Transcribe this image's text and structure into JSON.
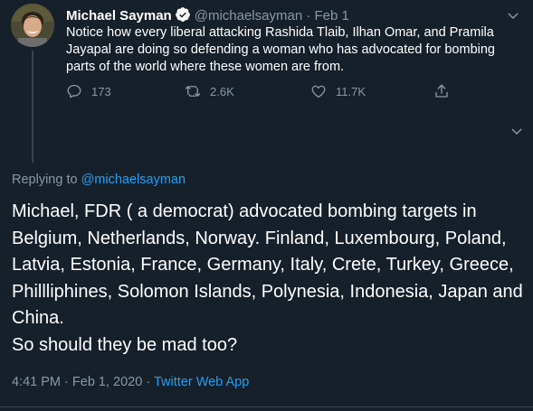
{
  "colors": {
    "background": "#15202b",
    "text_primary": "#ffffff",
    "text_secondary": "#8899a6",
    "accent": "#1da1f2",
    "divider": "#38444d"
  },
  "parent_tweet": {
    "display_name": "Michael Sayman",
    "verified_icon": "verified-badge-icon",
    "handle": "@michaelsayman",
    "separator": "·",
    "time": "Feb 1",
    "text": "Notice how every liberal attacking Rashida Tlaib, Ilhan Omar, and Pramila Jayapal are doing so defending a woman who has advocated for bombing parts of the world where these women are from.",
    "actions": {
      "reply_count": "173",
      "retweet_count": "2.6K",
      "like_count": "11.7K"
    }
  },
  "main_tweet": {
    "replying_prefix": "Replying to",
    "replying_handle": "@michaelsayman",
    "text_line1": "Michael, FDR ( a democrat) advocated bombing targets in Belgium, Netherlands, Norway. Finland, Luxembourg, Poland, Latvia, Estonia, France, Germany, Italy, Crete, Turkey, Greece, Phillliphines, Solomon Islands, Polynesia, Indonesia, Japan and China.",
    "text_line2": "So should they be mad too?",
    "time": "4:41 PM",
    "separator": "·",
    "date": "Feb 1, 2020",
    "source_separator": "·",
    "source": "Twitter Web App"
  }
}
